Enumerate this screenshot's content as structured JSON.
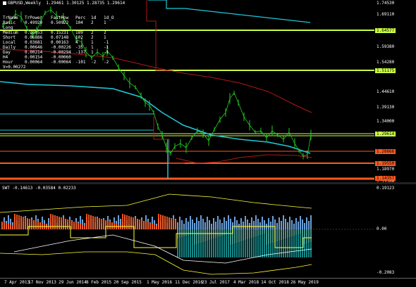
{
  "chart": {
    "title": "GBPUSD,Weekly",
    "ohlc": "1.29461 1.30125 1.28735 1.29614",
    "symbol": "GBPUSD",
    "timeframe": "Weekly"
  },
  "table": {
    "headers": [
      "TrName",
      "TrPower",
      "FastPow",
      "Perc",
      "1d",
      "1d_O"
    ],
    "rows": [
      [
        "Basic",
        "0.49920",
        "0.50922",
        "104",
        "2",
        "1"
      ],
      [
        "Long",
        "",
        "",
        "",
        "",
        ""
      ],
      [
        "Medium",
        "0.38053",
        "0.15231",
        "189",
        "2",
        "2"
      ],
      [
        "Short",
        "0.06886",
        "0.07148",
        "102",
        "2",
        "1"
      ],
      [
        "Local",
        "0.03681",
        "0.00163",
        "4",
        "1",
        "-1"
      ],
      [
        "Daily",
        "0.00646",
        "-0.00226",
        "-35",
        "1",
        "-1"
      ],
      [
        "Day",
        "0.00214",
        "-0.00294",
        "-137",
        "1",
        "-1"
      ],
      [
        "H4",
        "0.00154",
        "-0.00060",
        "",
        "",
        ""
      ],
      [
        "Hour",
        "0.00064",
        "-0.00064",
        "-101",
        "-2",
        "-2"
      ]
    ],
    "footer": "V=0.00272"
  },
  "price_axis": {
    "labels": [
      "1.74530",
      "1.69110",
      "1.64577",
      "1.59380",
      "1.54280",
      "1.51175",
      "1.44610",
      "1.39130",
      "1.34000",
      "1.29614",
      "1.28666",
      "1.19550",
      "1.18970",
      "1.14357",
      "1.13700"
    ],
    "tags": [
      {
        "text": "1.64577",
        "color": "#ccff44"
      },
      {
        "text": "1.51175",
        "color": "#ccff44"
      },
      {
        "text": "1.29614",
        "color": "#ccff44"
      },
      {
        "text": "1.28666",
        "color": "#ff5a1f"
      },
      {
        "text": "1.19550",
        "color": "#ff5a1f"
      },
      {
        "text": "1.14357",
        "color": "#ff5a1f"
      }
    ]
  },
  "indicator": {
    "label": "SWT -0.14613 -0.03584 0.02233",
    "axis": [
      "0.19123",
      "0.00",
      "-0.2083"
    ]
  },
  "time_axis": [
    "7 Apr 2013",
    "17 Nov 2013",
    "29 Jun 2014",
    "8 Feb 2015",
    "20 Sep 2015",
    "1 May 2016",
    "11 Dec 2016",
    "23 Jul 2017",
    "4 Mar 2018",
    "14 Oct 2018",
    "26 May 2019"
  ],
  "colors": {
    "background": "#000000",
    "candles": "#22cc22",
    "support_lines": "#ccff44",
    "resistance_lines": "#ff5a1f",
    "ma_cyan": "#1ec8d8",
    "ma_red": "#b01818",
    "swt_blue": "#6a9fd8",
    "swt_orange": "#ff5a1f",
    "swt_yellow": "#ffff33",
    "swt_teal": "#1aa8a8"
  }
}
